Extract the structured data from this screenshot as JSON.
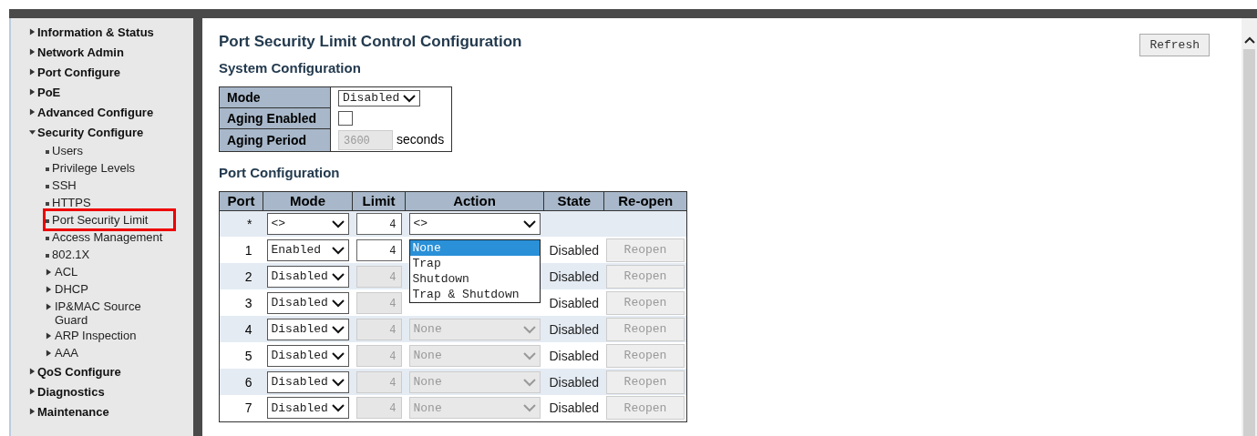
{
  "sidebar": {
    "items": [
      {
        "label": "Information & Status",
        "expanded": false
      },
      {
        "label": "Network Admin",
        "expanded": false
      },
      {
        "label": "Port Configure",
        "expanded": false
      },
      {
        "label": "PoE",
        "expanded": false
      },
      {
        "label": "Advanced Configure",
        "expanded": false
      },
      {
        "label": "Security Configure",
        "expanded": true,
        "children": [
          {
            "label": "Users",
            "kind": "page",
            "selected": false
          },
          {
            "label": "Privilege Levels",
            "kind": "page",
            "selected": false
          },
          {
            "label": "SSH",
            "kind": "page",
            "selected": false
          },
          {
            "label": "HTTPS",
            "kind": "page",
            "selected": false
          },
          {
            "label": "Port Security Limit",
            "kind": "page",
            "selected": true
          },
          {
            "label": "Access Management",
            "kind": "page",
            "selected": false
          },
          {
            "label": "802.1X",
            "kind": "page",
            "selected": false
          },
          {
            "label": "ACL",
            "kind": "folder",
            "selected": false
          },
          {
            "label": "DHCP",
            "kind": "folder",
            "selected": false
          },
          {
            "label": "IP&MAC Source Guard",
            "kind": "folder",
            "selected": false
          },
          {
            "label": "ARP Inspection",
            "kind": "folder",
            "selected": false
          },
          {
            "label": "AAA",
            "kind": "folder",
            "selected": false
          }
        ]
      },
      {
        "label": "QoS Configure",
        "expanded": false
      },
      {
        "label": "Diagnostics",
        "expanded": false
      },
      {
        "label": "Maintenance",
        "expanded": false
      }
    ]
  },
  "page": {
    "title": "Port Security Limit Control Configuration",
    "refresh_button": "Refresh",
    "system_configuration": {
      "title": "System Configuration",
      "mode_label": "Mode",
      "mode": "Disabled",
      "aging_enabled_label": "Aging Enabled",
      "aging_enabled": false,
      "aging_period_label": "Aging Period",
      "aging_period": "3600",
      "aging_period_disabled": true,
      "aging_period_unit": "seconds"
    },
    "port_configuration": {
      "title": "Port Configuration",
      "columns": [
        "Port",
        "Mode",
        "Limit",
        "Action",
        "State",
        "Re-open"
      ],
      "rows": [
        {
          "port": "*",
          "mode": "<>",
          "limit": "4",
          "limit_disabled": false,
          "action": "<>",
          "action_disabled": false
        },
        {
          "port": "1",
          "mode": "Enabled",
          "limit": "4",
          "limit_disabled": false,
          "action_dropdown": {
            "options": [
              {
                "label": "None",
                "selected": true
              },
              {
                "label": "Trap",
                "selected": false
              },
              {
                "label": "Shutdown",
                "selected": false
              },
              {
                "label": "Trap & Shutdown",
                "selected": false
              }
            ]
          },
          "state": "Disabled",
          "reopen": "Reopen",
          "reopen_disabled": true
        },
        {
          "port": "2",
          "mode": "Disabled",
          "limit": "4",
          "limit_disabled": true,
          "state": "Disabled",
          "reopen": "Reopen",
          "reopen_disabled": true
        },
        {
          "port": "3",
          "mode": "Disabled",
          "limit": "4",
          "limit_disabled": true,
          "state": "Disabled",
          "reopen": "Reopen",
          "reopen_disabled": true
        },
        {
          "port": "4",
          "mode": "Disabled",
          "limit": "4",
          "limit_disabled": true,
          "action": "None",
          "action_disabled": true,
          "state": "Disabled",
          "reopen": "Reopen",
          "reopen_disabled": true
        },
        {
          "port": "5",
          "mode": "Disabled",
          "limit": "4",
          "limit_disabled": true,
          "action": "None",
          "action_disabled": true,
          "state": "Disabled",
          "reopen": "Reopen",
          "reopen_disabled": true
        },
        {
          "port": "6",
          "mode": "Disabled",
          "limit": "4",
          "limit_disabled": true,
          "action": "None",
          "action_disabled": true,
          "state": "Disabled",
          "reopen": "Reopen",
          "reopen_disabled": true
        },
        {
          "port": "7",
          "mode": "Disabled",
          "limit": "4",
          "limit_disabled": true,
          "action": "None",
          "action_disabled": true,
          "state": "Disabled",
          "reopen": "Reopen",
          "reopen_disabled": true
        }
      ]
    }
  }
}
